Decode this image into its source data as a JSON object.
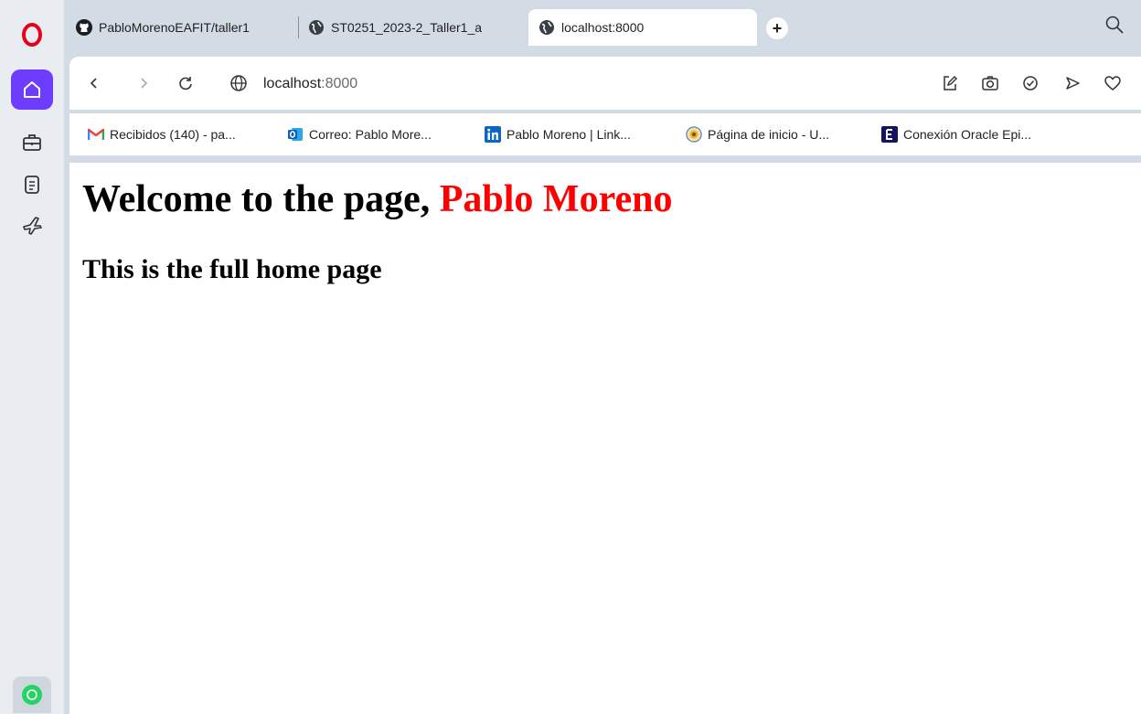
{
  "tabs": [
    {
      "title": "PabloMorenoEAFIT/taller1",
      "icon": "github-icon"
    },
    {
      "title": "ST0251_2023-2_Taller1_a",
      "icon": "globe-icon"
    },
    {
      "title": "localhost:8000",
      "icon": "globe-icon",
      "active": true
    }
  ],
  "address": {
    "host": "localhost",
    "port": ":8000"
  },
  "bookmarks": [
    {
      "label": "Recibidos (140) - pa...",
      "icon": "gmail-icon"
    },
    {
      "label": "Correo: Pablo More...",
      "icon": "outlook-icon"
    },
    {
      "label": "Pablo Moreno | Link...",
      "icon": "linkedin-icon"
    },
    {
      "label": "Página de inicio - U...",
      "icon": "site-icon"
    },
    {
      "label": "Conexión Oracle Epi...",
      "icon": "e-icon"
    }
  ],
  "page": {
    "welcome_prefix": "Welcome to the page, ",
    "user_name": "Pablo Moreno",
    "subtitle": "This is the full home page"
  },
  "colors": {
    "user_name": "#ff0000",
    "sidebar_accent": "#6d3cff"
  }
}
